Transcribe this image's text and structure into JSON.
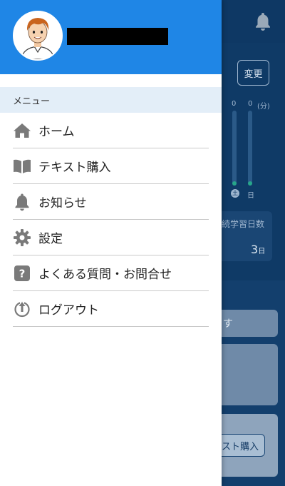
{
  "drawer": {
    "username": "",
    "section_label": "メニュー",
    "items": [
      {
        "label": "ホーム",
        "icon": "home-icon"
      },
      {
        "label": "テキスト購入",
        "icon": "book-icon"
      },
      {
        "label": "お知らせ",
        "icon": "bell-icon"
      },
      {
        "label": "設定",
        "icon": "gear-icon"
      },
      {
        "label": "よくある質問・お問合せ",
        "icon": "help-icon"
      },
      {
        "label": "ログアウト",
        "icon": "power-icon"
      }
    ]
  },
  "background": {
    "change_button": "変更",
    "chart_unit": "(分)",
    "chart_values": [
      "0",
      "0"
    ],
    "chart_days": [
      "土",
      "日"
    ],
    "streak_label": "続学習日数",
    "streak_value": "3",
    "streak_unit": "日",
    "card_text": "す",
    "buy_button": "スト購入"
  },
  "colors": {
    "header_blue": "#1f86e6",
    "section_bg": "#e3eef8",
    "icon_gray": "#7a7a7a"
  }
}
